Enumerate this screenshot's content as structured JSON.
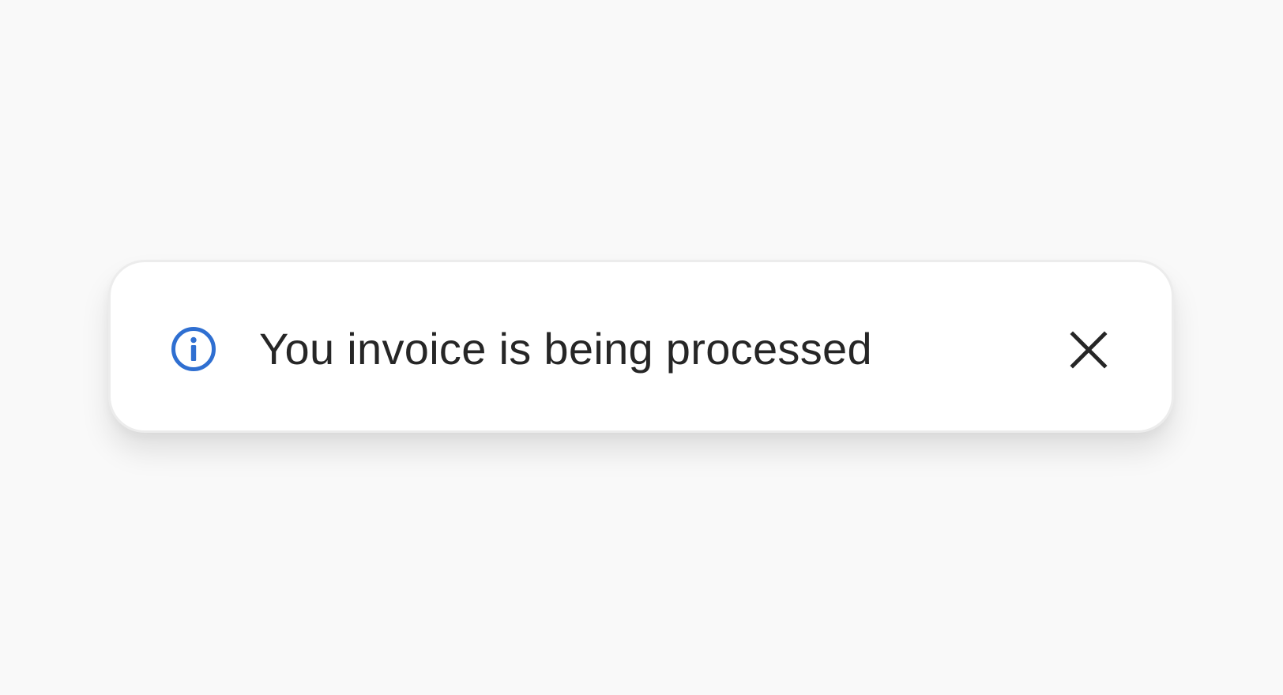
{
  "toast": {
    "message": "You invoice is being processed",
    "icon": "info-icon",
    "close_icon": "close-icon",
    "colors": {
      "background_page": "#f9f9f9",
      "toast_background": "#ffffff",
      "toast_border": "#ececec",
      "info_accent": "#2f6fd1",
      "text": "#262626",
      "close_icon": "#262626"
    }
  }
}
